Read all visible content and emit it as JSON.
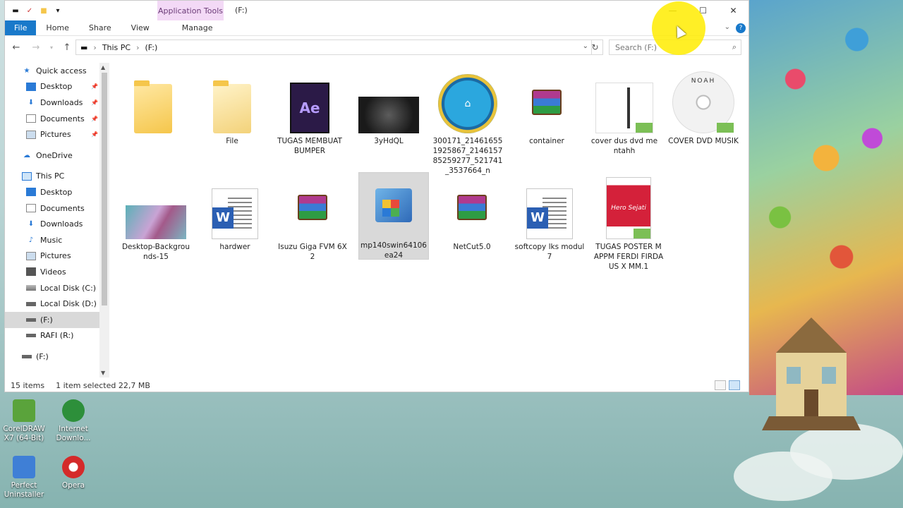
{
  "titlebar": {
    "context_tab": "Application Tools",
    "title": "(F:)",
    "minimize": "—",
    "maximize": "☐",
    "close": "✕"
  },
  "ribbon": {
    "tabs": [
      "File",
      "Home",
      "Share",
      "View",
      "Manage"
    ],
    "help": "?"
  },
  "address": {
    "segments": [
      "This PC",
      "(F:)"
    ],
    "search_placeholder": "Search (F:)"
  },
  "navpane": {
    "items": [
      {
        "label": "Quick access",
        "icon": "star-icon"
      },
      {
        "label": "Desktop",
        "icon": "desktop-icon",
        "pinned": true
      },
      {
        "label": "Downloads",
        "icon": "download-icon",
        "pinned": true
      },
      {
        "label": "Documents",
        "icon": "documents-icon",
        "pinned": true
      },
      {
        "label": "Pictures",
        "icon": "pictures-icon",
        "pinned": true
      },
      {
        "label": "OneDrive",
        "icon": "cloud-icon"
      },
      {
        "label": "This PC",
        "icon": "computer-icon"
      },
      {
        "label": "Desktop",
        "icon": "desktop-icon"
      },
      {
        "label": "Documents",
        "icon": "documents-icon"
      },
      {
        "label": "Downloads",
        "icon": "download-icon"
      },
      {
        "label": "Music",
        "icon": "music-icon"
      },
      {
        "label": "Pictures",
        "icon": "pictures-icon"
      },
      {
        "label": "Videos",
        "icon": "videos-icon"
      },
      {
        "label": "Local Disk (C:)",
        "icon": "drive-icon"
      },
      {
        "label": "Local Disk (D:)",
        "icon": "drive-icon"
      },
      {
        "label": "(F:)",
        "icon": "usb-drive-icon",
        "selected": true
      },
      {
        "label": "RAFI (R:)",
        "icon": "usb-drive-icon"
      },
      {
        "label": "(F:)",
        "icon": "usb-drive-icon"
      }
    ]
  },
  "files": [
    {
      "name": "",
      "type": "folder"
    },
    {
      "name": "File",
      "type": "folder"
    },
    {
      "name": "TUGAS MEMBUAT BUMPER",
      "type": "folder"
    },
    {
      "name": "3yHdQL",
      "type": "image"
    },
    {
      "name": "300171_214616551925867_214615785259277_521741_3537664_n",
      "type": "image"
    },
    {
      "name": "container",
      "type": "rar"
    },
    {
      "name": "cover dus dvd mentahh",
      "type": "image"
    },
    {
      "name": "COVER DVD MUSIK",
      "type": "image"
    },
    {
      "name": "Desktop-Backgrounds-15",
      "type": "image"
    },
    {
      "name": "hardwer",
      "type": "word"
    },
    {
      "name": "Isuzu Giga FVM 6X2",
      "type": "rar"
    },
    {
      "name": "mp140swin64106ea24",
      "type": "installer",
      "selected": true
    },
    {
      "name": "NetCut5.0",
      "type": "rar"
    },
    {
      "name": "softcopy lks modul 7",
      "type": "word"
    },
    {
      "name": "TUGAS POSTER MAPPM FERDI FIRDAUS X MM.1",
      "type": "image"
    }
  ],
  "thumb_text": {
    "ae": "Ae",
    "noah": "NOAH",
    "poster": "Hero Sejati",
    "word": "W"
  },
  "status": {
    "items_count": "15 items",
    "selection": "1 item selected  22,7 MB"
  },
  "desktop_icons": [
    {
      "label": "CorelDRAW X7 (64-Bit)",
      "color": "#5aa33b"
    },
    {
      "label": "Internet Downlo...",
      "color": "#2d8f3a"
    },
    {
      "label": "Perfect Uninstaller",
      "color": "#3f7fd6"
    },
    {
      "label": "Opera",
      "color": "#d42a2a"
    }
  ],
  "colors": {
    "accent": "#1979ca",
    "context_tab": "#f3d9f6"
  }
}
